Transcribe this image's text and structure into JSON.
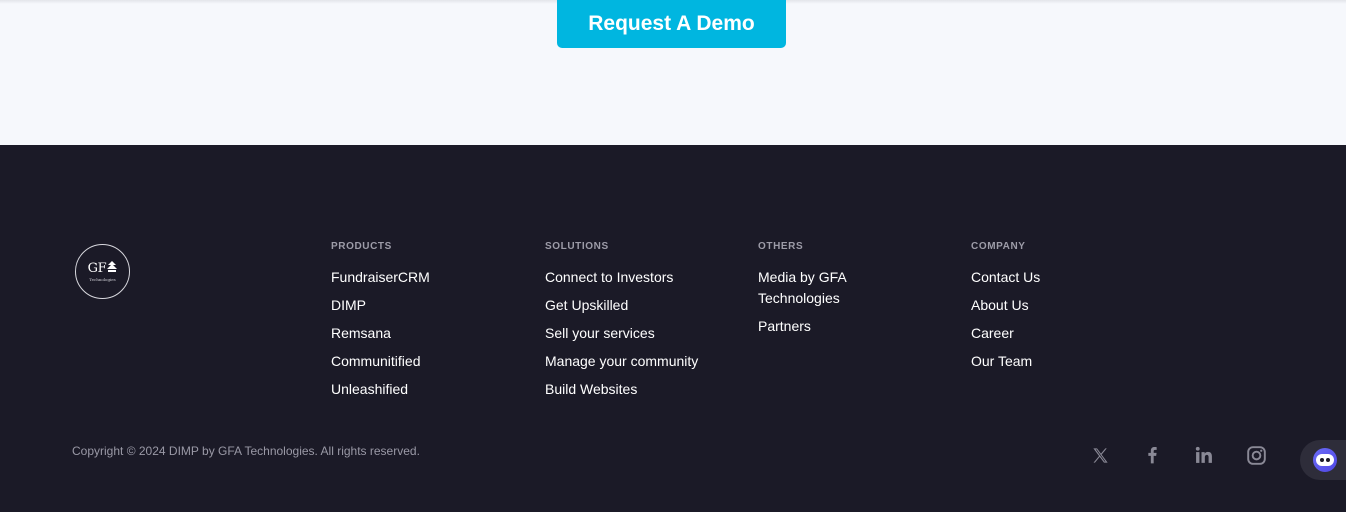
{
  "cta": {
    "label": "Request A Demo"
  },
  "logo": {
    "main": "GF",
    "sub": "Technologies"
  },
  "columns": [
    {
      "heading": "PRODUCTS",
      "links": [
        "FundraiserCRM",
        "DIMP",
        "Remsana",
        "Communitified",
        "Unleashified"
      ]
    },
    {
      "heading": "SOLUTIONS",
      "links": [
        "Connect to Investors",
        "Get Upskilled",
        "Sell your services",
        "Manage your community",
        "Build Websites"
      ]
    },
    {
      "heading": "OTHERS",
      "links": [
        "Media by GFA Technologies",
        "Partners"
      ]
    },
    {
      "heading": "COMPANY",
      "links": [
        "Contact Us",
        "About Us",
        "Career",
        "Our Team"
      ]
    }
  ],
  "copyright": "Copyright © 2024 DIMP by GFA Technologies. All rights reserved.",
  "social_icons": [
    "x-icon",
    "facebook-icon",
    "linkedin-icon",
    "instagram-icon"
  ],
  "chat_widget": {
    "icon": "chat-bot-icon"
  },
  "colors": {
    "accent": "#00b6e0",
    "footer_bg": "#1b1a27",
    "top_bg": "#f6f8fc",
    "heading": "#9d9ca8",
    "link": "#ffffff",
    "social": "#8a8996"
  }
}
